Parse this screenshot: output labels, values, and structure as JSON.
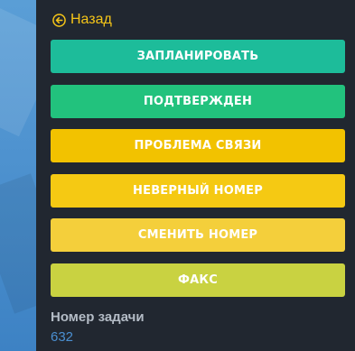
{
  "nav": {
    "back_label": "Назад",
    "back_icon": "arrow-left-circle-icon"
  },
  "actions": [
    {
      "label": "ЗАПЛАНИРОВАТЬ",
      "color": "#1dbc9a"
    },
    {
      "label": "ПОДТВЕРЖДЕН",
      "color": "#22c27d"
    },
    {
      "label": "ПРОБЛЕМА СВЯЗИ",
      "color": "#f2c200"
    },
    {
      "label": "НЕВЕРНЫЙ НОМЕР",
      "color": "#f5c913"
    },
    {
      "label": "СМЕНИТЬ НОМЕР",
      "color": "#f4cf3b"
    },
    {
      "label": "ФАКС",
      "color": "#c9d241"
    }
  ],
  "task": {
    "label": "Номер задачи",
    "value": "632"
  },
  "colors": {
    "panel_bg": "#212730",
    "accent": "#f5c518",
    "link": "#4a8fd1"
  }
}
